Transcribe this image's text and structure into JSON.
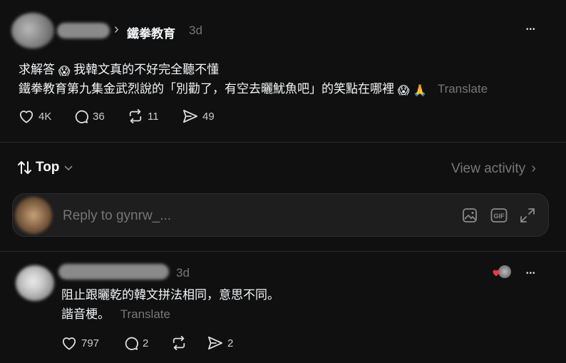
{
  "post": {
    "breadcrumb_sep": "›",
    "account": "鐵拳教育",
    "time": "3d",
    "more": "•••",
    "line1_text": "求解答",
    "line1_emoji": "😱",
    "line1_rest": "我韓文真的不好完全聽不懂",
    "line2_text": "鐵拳教育第九集金武烈說的「別勸了，有空去曬魷魚吧」的笑點在哪裡",
    "line2_emoji1": "😱",
    "line2_emoji2": "🙏",
    "translate": "Translate",
    "likes": "4K",
    "comments": "36",
    "reposts": "11",
    "shares": "49"
  },
  "sort": {
    "label": "Top",
    "view_activity": "View activity",
    "chevron": "›"
  },
  "reply_box": {
    "placeholder": "Reply to gynrw_..."
  },
  "reply": {
    "time": "3d",
    "more": "•••",
    "line1": "阻止跟曬乾的韓文拼法相同，意思不同。",
    "line2": "諧音梗。",
    "translate": "Translate",
    "likes": "797",
    "comments": "2",
    "shares": "2"
  },
  "colors": {
    "background": "#101010",
    "text": "#f3f5f7",
    "muted": "#777777",
    "divider": "#2a2a2a",
    "input_bg": "#1e1e1e",
    "heart": "#ff3040"
  },
  "icons": [
    "chevron-right-icon",
    "more-icon",
    "heart-icon",
    "comment-icon",
    "repost-icon",
    "share-icon",
    "sort-icon",
    "chevron-down-icon",
    "image-icon",
    "gif-icon",
    "expand-icon"
  ]
}
